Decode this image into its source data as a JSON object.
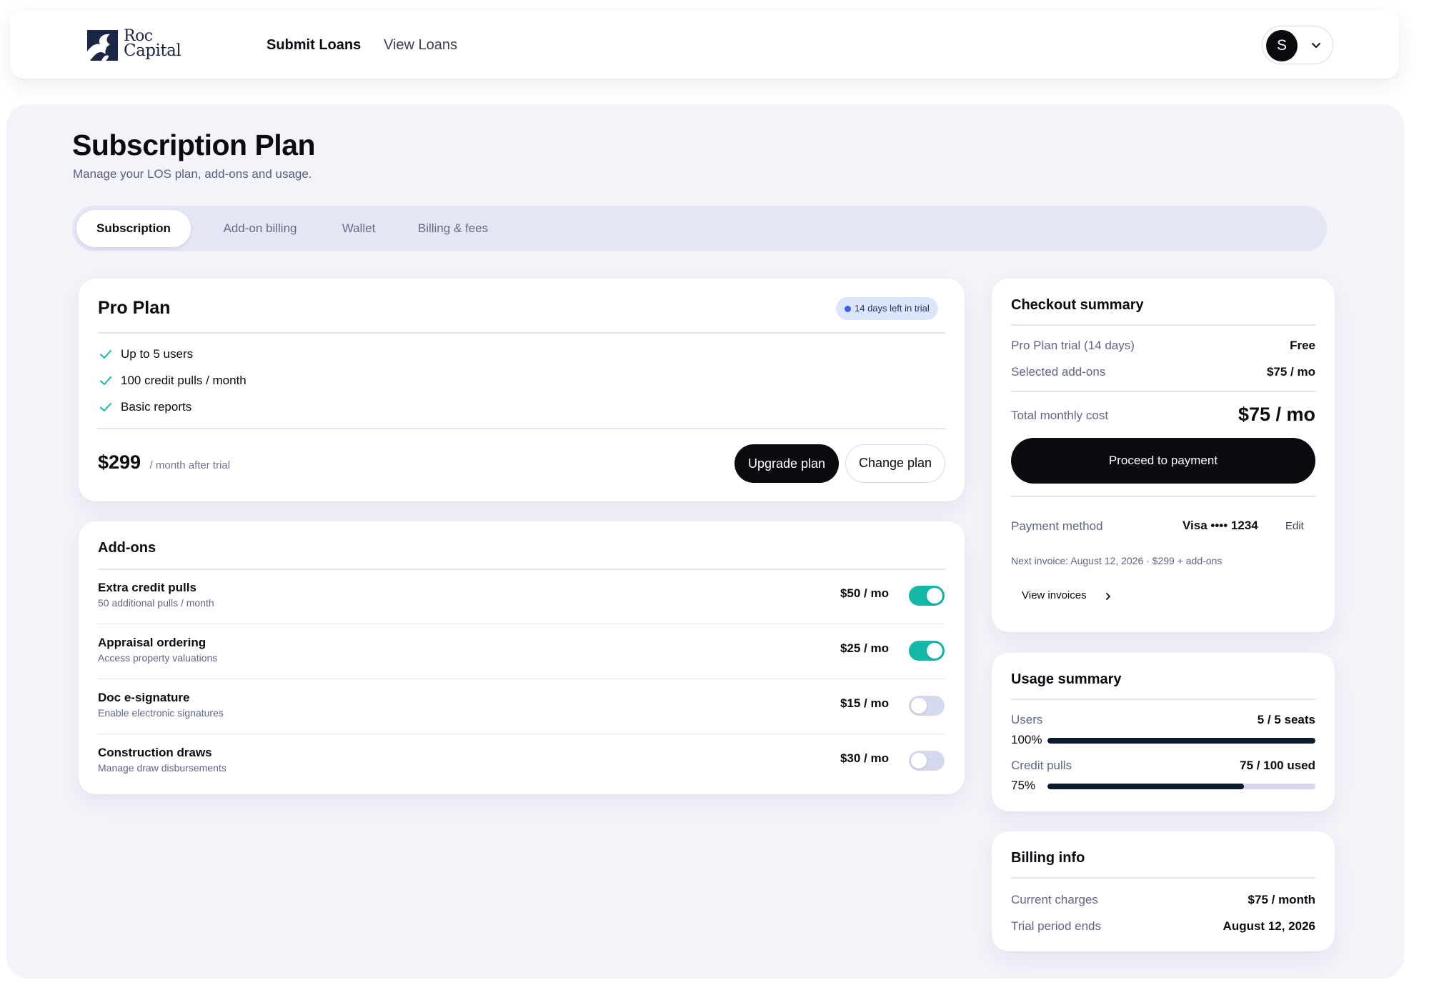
{
  "brand": {
    "logo_line1": "Roc",
    "logo_line2": "Capital"
  },
  "nav": {
    "items": [
      "Submit Loans",
      "View Loans"
    ],
    "active": "Submit Loans"
  },
  "account": {
    "avatar_initial": "S"
  },
  "page": {
    "title": "Subscription Plan",
    "subtitle": "Manage your LOS plan, add-ons and usage."
  },
  "tabs": [
    {
      "label": "Subscription",
      "active": true
    },
    {
      "label": "Add-on billing",
      "active": false
    },
    {
      "label": "Wallet",
      "active": false
    },
    {
      "label": "Billing & fees",
      "active": false
    }
  ],
  "plan": {
    "name": "Pro Plan",
    "trial_badge": "14 days left in trial",
    "features": [
      "Up to 5 users",
      "100 credit pulls / month",
      "Basic reports"
    ],
    "price": "$299",
    "price_note": "/ month after trial",
    "upgrade_label": "Upgrade plan",
    "change_label": "Change plan"
  },
  "addons": {
    "title": "Add-ons",
    "items": [
      {
        "name": "Extra credit pulls",
        "description": "50 additional pulls / month",
        "price": "$50 / mo",
        "enabled": true
      },
      {
        "name": "Appraisal ordering",
        "description": "Access property valuations",
        "price": "$25 / mo",
        "enabled": true
      },
      {
        "name": "Doc e-signature",
        "description": "Enable electronic signatures",
        "price": "$15 / mo",
        "enabled": false
      },
      {
        "name": "Construction draws",
        "description": "Manage draw disbursements",
        "price": "$30 / mo",
        "enabled": false
      }
    ]
  },
  "checkout": {
    "title": "Checkout summary",
    "plan_label": "Pro Plan trial (14 days)",
    "plan_value": "Free",
    "addons_label": "Selected add-ons",
    "addons_value": "$75 / mo",
    "total_label": "Total monthly cost",
    "total_value": "$75 / mo",
    "pay_button": "Proceed to payment",
    "payment_method_label": "Payment method",
    "payment_method_value": "Visa •••• 1234",
    "edit_label": "Edit",
    "next_invoice": "Next invoice: August 12, 2026 · $299 + add-ons",
    "view_invoices": "View invoices"
  },
  "usage": {
    "title": "Usage summary",
    "rows": [
      {
        "label": "Users",
        "value": "5 / 5 seats",
        "percent_label": "100%",
        "fraction": 1.0
      },
      {
        "label": "Credit pulls",
        "value": "75 / 100 used",
        "percent_label": "75%",
        "fraction": 0.75
      }
    ]
  },
  "billing": {
    "title": "Billing info",
    "current_label": "Current charges",
    "current_value": "$75 / month",
    "trial_label": "Trial period ends",
    "trial_value": "August 12, 2026"
  },
  "colors": {
    "accent_toggle_on": "#14b8a6",
    "toggle_off": "#d5d9f0",
    "primary_button": "#0a0a0f",
    "trial_badge_bg": "#dde5fd",
    "trial_dot": "#3a62e8",
    "check": "#14b8a6",
    "progress_fill": "#0b1b2e"
  },
  "icons": {
    "feature_check": "check-icon",
    "account_menu": "chevron-down-icon",
    "view_invoices": "chevron-right-icon"
  }
}
